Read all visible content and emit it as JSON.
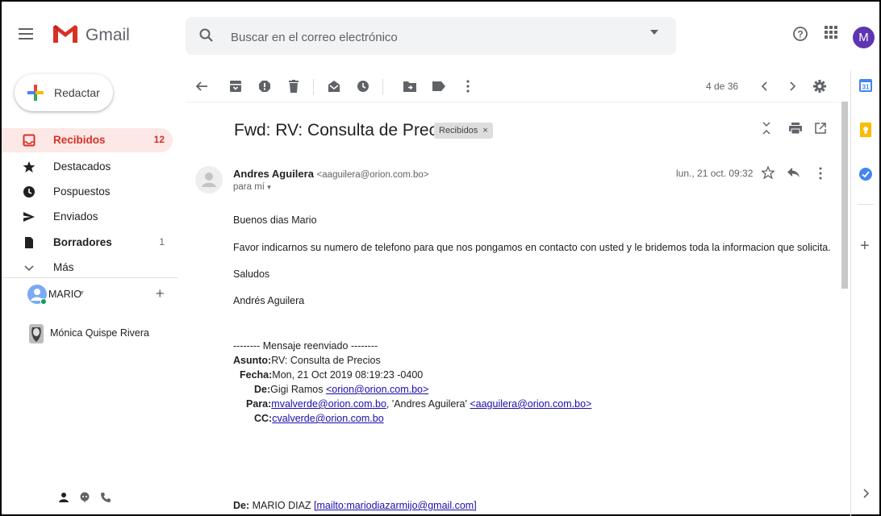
{
  "header": {
    "app_name": "Gmail",
    "search_placeholder": "Buscar en el correo electrónico",
    "avatar_initial": "M"
  },
  "sidebar": {
    "compose_label": "Redactar",
    "items": [
      {
        "label": "Recibidos",
        "count": "12",
        "icon": "inbox-icon"
      },
      {
        "label": "Destacados",
        "count": "",
        "icon": "star-icon"
      },
      {
        "label": "Pospuestos",
        "count": "",
        "icon": "clock-icon"
      },
      {
        "label": "Enviados",
        "count": "",
        "icon": "send-icon"
      },
      {
        "label": "Borradores",
        "count": "1",
        "icon": "draft-icon"
      },
      {
        "label": "Más",
        "count": "",
        "icon": "chevron-down-icon"
      }
    ],
    "hangouts_user": "MARIO",
    "hangouts_contact": "Mónica Quispe Rivera"
  },
  "toolbar": {
    "pager": "4 de 36"
  },
  "message": {
    "subject": "Fwd: RV: Consulta de Precios",
    "label_chip": "Recibidos",
    "sender_name": "Andres Aguilera",
    "sender_email": "<aaguilera@orion.com.bo>",
    "recipient": "para mí",
    "date": "lun., 21 oct. 09:32",
    "body": [
      "Buenos dias Mario",
      "Favor indicarnos su numero de telefono para que nos pongamos en contacto con usted y le bridemos toda la informacion que solicita.",
      "Saludos",
      "Andrés Aguilera"
    ],
    "forward": {
      "header": "-------- Mensaje reenviado --------",
      "asunto_label": "Asunto:",
      "asunto": "RV: Consulta de Precios",
      "fecha_label": "Fecha:",
      "fecha": "Mon, 21 Oct 2019 08:19:23 -0400",
      "de_label": "De:",
      "de_name": "Gigi Ramos",
      "de_email": "<orion@orion.com.bo>",
      "para_label": "Para:",
      "para_email1": "mvalverde@orion.com.bo",
      "para_sep": ", 'Andres Aguilera' ",
      "para_email2": "<aaguilera@orion.com.bo>",
      "cc_label": "CC:",
      "cc_email": "cvalverde@orion.com.bo"
    },
    "quoted": {
      "de_label": "De:",
      "de_name": " MARIO DIAZ ",
      "de_link": "[mailto:mariodiazarmijo@gmail.com]"
    }
  },
  "colors": {
    "accent_red": "#d93025",
    "active_bg": "#fce8e6",
    "link": "#1a0dab",
    "avatar": "#5e35b1"
  }
}
